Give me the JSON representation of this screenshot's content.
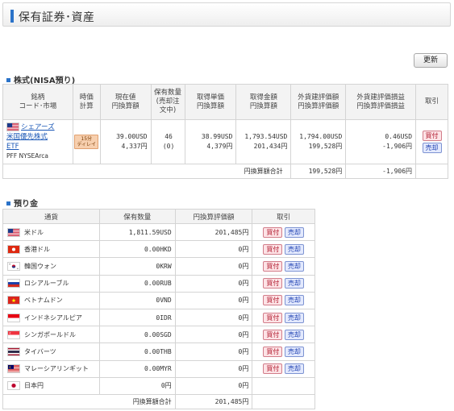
{
  "header": {
    "title": "保有証券･資産"
  },
  "refresh_label": "更新",
  "stock_section": {
    "title": "株式(NISA預り)",
    "columns": [
      "銘柄\nコード･市場",
      "時価\n計算",
      "現在値\n円換算額",
      "保有数量\n(売却注\n文中)",
      "取得単価\n円換算額",
      "取得金額\n円換算額",
      "外貨建評価額\n円換算評価額",
      "外貨建評価損益\n円換算評価損益",
      "取引"
    ],
    "row": {
      "name_lines": [
        "シェアーズ",
        "米国優先株式",
        "ETF"
      ],
      "code_market": "PFF NYSEArca",
      "delay_line1": "15分",
      "delay_line2": "ディレイ",
      "price_usd": "39.00USD",
      "price_jpy": "4,337円",
      "qty": "46",
      "qty_pending": "(0)",
      "unit_cost_usd": "38.99USD",
      "unit_cost_jpy": "4,379円",
      "cost_usd": "1,793.54USD",
      "cost_jpy": "201,434円",
      "value_usd": "1,794.00USD",
      "value_jpy": "199,528円",
      "pl_usd": "0.46USD",
      "pl_jpy": "-1,906円",
      "buy": "買付",
      "sell": "売却"
    },
    "total_label": "円換算額合計",
    "total_value": "199,528円",
    "total_pl": "-1,906円"
  },
  "deposit_section": {
    "title": "預り金",
    "columns": [
      "通貨",
      "保有数量",
      "円換算評価額",
      "取引"
    ],
    "rows": [
      {
        "flag": "us-flag",
        "currency": "米ドル",
        "qty": "1,811.59USD",
        "jpy": "201,485円",
        "buy": "買付",
        "sell": "売却"
      },
      {
        "flag": "hk-flag",
        "currency": "香港ドル",
        "qty": "0.00HKD",
        "jpy": "0円",
        "buy": "買付",
        "sell": "売却"
      },
      {
        "flag": "kr-flag",
        "currency": "韓国ウォン",
        "qty": "0KRW",
        "jpy": "0円",
        "buy": "買付",
        "sell": "売却"
      },
      {
        "flag": "ru-flag",
        "currency": "ロシアルーブル",
        "qty": "0.00RUB",
        "jpy": "0円",
        "buy": "買付",
        "sell": "売却"
      },
      {
        "flag": "vn-flag",
        "currency": "ベトナムドン",
        "qty": "0VND",
        "jpy": "0円",
        "buy": "買付",
        "sell": "売却"
      },
      {
        "flag": "id-flag",
        "currency": "インドネシアルピア",
        "qty": "0IDR",
        "jpy": "0円",
        "buy": "買付",
        "sell": "売却"
      },
      {
        "flag": "sg-flag",
        "currency": "シンガポールドル",
        "qty": "0.00SGD",
        "jpy": "0円",
        "buy": "買付",
        "sell": "売却"
      },
      {
        "flag": "th-flag",
        "currency": "タイバーツ",
        "qty": "0.00THB",
        "jpy": "0円",
        "buy": "買付",
        "sell": "売却"
      },
      {
        "flag": "my-flag",
        "currency": "マレーシアリンギット",
        "qty": "0.00MYR",
        "jpy": "0円",
        "buy": "買付",
        "sell": "売却"
      },
      {
        "flag": "jp-flag",
        "currency": "日本円",
        "qty": "0円",
        "jpy": "0円"
      }
    ],
    "total_label": "円換算額合計",
    "total_value": "201,485円"
  }
}
